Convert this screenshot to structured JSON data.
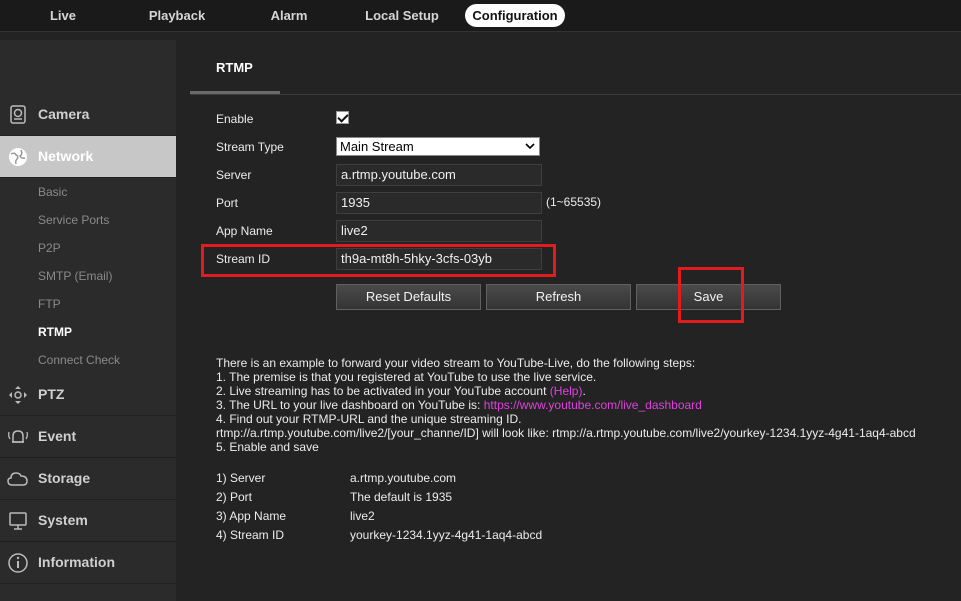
{
  "topnav": {
    "tabs": [
      {
        "label": "Live"
      },
      {
        "label": "Playback"
      },
      {
        "label": "Alarm"
      },
      {
        "label": "Local Setup"
      },
      {
        "label": "Configuration"
      }
    ]
  },
  "sidebar": {
    "camera": "Camera",
    "network": "Network",
    "sub": [
      "Basic",
      "Service Ports",
      "P2P",
      "SMTP (Email)",
      "FTP",
      "RTMP",
      "Connect Check"
    ],
    "ptz": "PTZ",
    "event": "Event",
    "storage": "Storage",
    "system": "System",
    "information": "Information"
  },
  "page": {
    "tab": "RTMP",
    "enable_label": "Enable",
    "stream_type_label": "Stream Type",
    "stream_type_value": "Main Stream",
    "server_label": "Server",
    "server_value": "a.rtmp.youtube.com",
    "port_label": "Port",
    "port_value": "1935",
    "port_hint": "(1~65535)",
    "app_name_label": "App Name",
    "app_name_value": "live2",
    "stream_id_label": "Stream ID",
    "stream_id_value": "th9a-mt8h-5hky-3cfs-03yb",
    "buttons": {
      "reset": "Reset Defaults",
      "refresh": "Refresh",
      "save": "Save"
    }
  },
  "info": {
    "intro": "There is an example to forward your video stream to YouTube-Live, do the following steps:",
    "step1": "1. The premise is that you registered at YouTube to use the live service.",
    "step2": "2. Live streaming has to be activated in your YouTube account ",
    "step2_link": "(Help)",
    "step2_end": ".",
    "step3": "3. The URL to your live dashboard on YouTube is: ",
    "step3_link": "https://www.youtube.com/live_dashboard",
    "step4": "4. Find out your RTMP-URL and the unique streaming ID.",
    "example": "rtmp://a.rtmp.youtube.com/live2/[your_channe/ID] will look like: rtmp://a.rtmp.youtube.com/live2/yourkey-1234.1yyz-4g41-1aq4-abcd",
    "step5": "5. Enable and save",
    "kv": [
      {
        "k": "1) Server",
        "v": "a.rtmp.youtube.com"
      },
      {
        "k": "2) Port",
        "v": "The default is 1935"
      },
      {
        "k": "3) App Name",
        "v": "live2"
      },
      {
        "k": "4) Stream ID",
        "v": "yourkey-1234.1yyz-4g41-1aq4-abcd"
      }
    ]
  }
}
